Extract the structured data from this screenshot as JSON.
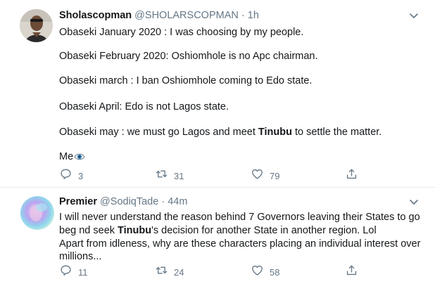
{
  "tweets": [
    {
      "display_name": "Sholascopman",
      "handle": "@SHOLARSCOPMAN",
      "separator": "·",
      "time": "1h",
      "lines": [
        "Obaseki January 2020 : I was choosing by my people.",
        "Obaseki February 2020: Oshiomhole is no Apc chairman.",
        "Obaseki march : I ban Oshiomhole coming to Edo state.",
        "Obaseki April: Edo is not Lagos state.",
        "Obaseki may : we must go Lagos and meet ",
        "Tinubu",
        " to settle the matter.",
        "Me"
      ],
      "replies": "3",
      "retweets": "31",
      "likes": "79"
    },
    {
      "display_name": "Premier",
      "handle": "@SodiqTade",
      "separator": "·",
      "time": "44m",
      "lines": [
        "I will never understand the reason behind 7 Governors leaving their States to go",
        "beg nd seek ",
        "Tinubu",
        "'s decision for another State in another region. Lol",
        "Apart from idleness, why are these characters placing an individual interest over",
        "millions..."
      ],
      "replies": "11",
      "retweets": "24",
      "likes": "58"
    }
  ],
  "colors": {
    "text": "#14171a",
    "secondary": "#657786",
    "divider": "#e6ecf0"
  },
  "icons": [
    "reply-icon",
    "retweet-icon",
    "like-icon",
    "share-icon",
    "chevron-down-icon",
    "eye-emoji-icon"
  ]
}
